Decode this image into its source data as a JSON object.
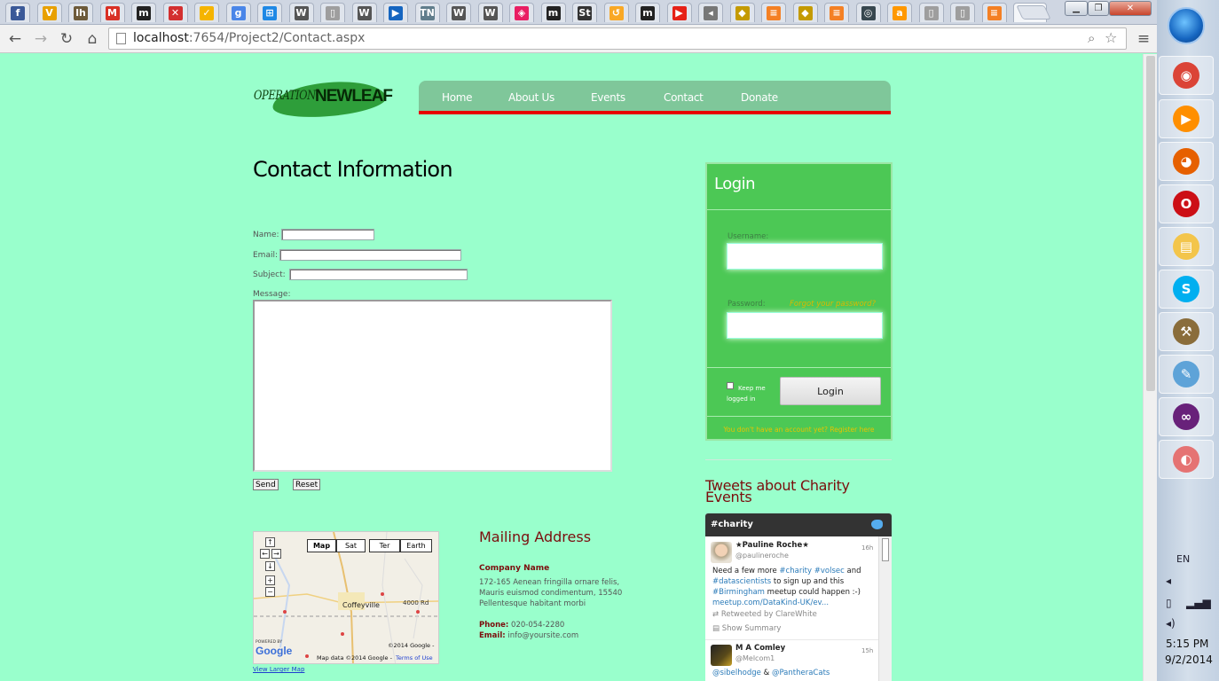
{
  "browser": {
    "tabs": [
      {
        "icon": "facebook-icon",
        "glyph": "f",
        "color": "#3b5998"
      },
      {
        "icon": "v-icon",
        "glyph": "V",
        "color": "#e8a000"
      },
      {
        "icon": "lh-icon",
        "glyph": "lh",
        "color": "#6d5a3a"
      },
      {
        "icon": "gmail-icon",
        "glyph": "M",
        "color": "#d93025"
      },
      {
        "icon": "m-icon",
        "glyph": "m",
        "color": "#222222"
      },
      {
        "icon": "x-icon",
        "glyph": "✕",
        "color": "#d32f2f"
      },
      {
        "icon": "check-icon",
        "glyph": "✓",
        "color": "#f5b400"
      },
      {
        "icon": "g-icon",
        "glyph": "g",
        "color": "#4a86e8"
      },
      {
        "icon": "windows-icon",
        "glyph": "⊞",
        "color": "#1e88e5"
      },
      {
        "icon": "wikipedia-icon",
        "glyph": "W",
        "color": "#555555"
      },
      {
        "icon": "page-icon",
        "glyph": "▯",
        "color": "#9e9e9e"
      },
      {
        "icon": "wikipedia-icon",
        "glyph": "W",
        "color": "#555555"
      },
      {
        "icon": "flag-icon",
        "glyph": "▶",
        "color": "#1565c0"
      },
      {
        "icon": "tn-icon",
        "glyph": "TN",
        "color": "#607d8b"
      },
      {
        "icon": "wikipedia-icon",
        "glyph": "W",
        "color": "#555555"
      },
      {
        "icon": "wikipedia-icon",
        "glyph": "W",
        "color": "#555555"
      },
      {
        "icon": "tag-icon",
        "glyph": "◈",
        "color": "#e91e63"
      },
      {
        "icon": "m-icon",
        "glyph": "m",
        "color": "#222222"
      },
      {
        "icon": "st-icon",
        "glyph": "St",
        "color": "#333333"
      },
      {
        "icon": "arrow-icon",
        "glyph": "↺",
        "color": "#f9a825"
      },
      {
        "icon": "m-icon",
        "glyph": "m",
        "color": "#222222"
      },
      {
        "icon": "youtube-icon",
        "glyph": "▶",
        "color": "#e62117"
      },
      {
        "icon": "speaker-icon",
        "glyph": "◂",
        "color": "#777777"
      },
      {
        "icon": "shield-icon",
        "glyph": "◆",
        "color": "#c49a00"
      },
      {
        "icon": "stack-icon",
        "glyph": "≡",
        "color": "#f48024"
      },
      {
        "icon": "shield-icon",
        "glyph": "◆",
        "color": "#c49a00"
      },
      {
        "icon": "stack-icon",
        "glyph": "≡",
        "color": "#f48024"
      },
      {
        "icon": "circle-icon",
        "glyph": "◎",
        "color": "#37474f"
      },
      {
        "icon": "a-icon",
        "glyph": "a",
        "color": "#ff9800"
      },
      {
        "icon": "page-icon",
        "glyph": "▯",
        "color": "#9e9e9e"
      },
      {
        "icon": "page-icon",
        "glyph": "▯",
        "color": "#9e9e9e"
      },
      {
        "icon": "stack-icon",
        "glyph": "≡",
        "color": "#f48024"
      }
    ],
    "active_tab_close": "×",
    "url_host": "localhost",
    "url_rest": ":7654/Project2/Contact.aspx"
  },
  "site": {
    "logo": {
      "part1": "OPERATION",
      "part2": "NEWLEAF"
    },
    "nav": [
      "Home",
      "About Us",
      "Events",
      "Contact",
      "Donate"
    ]
  },
  "contact": {
    "title": "Contact Information",
    "name_label": "Name:",
    "email_label": "Email:",
    "subject_label": "Subject:",
    "message_label": "Message:",
    "send_label": "Send",
    "reset_label": "Reset"
  },
  "map": {
    "controls": {
      "up": "↑",
      "left": "←",
      "right": "→",
      "down": "↓",
      "zoom_in": "+",
      "zoom_out": "−"
    },
    "types": [
      "Map",
      "Sat",
      "Ter",
      "Earth"
    ],
    "city": "Coffeyville",
    "road": "4000 Rd",
    "copyright": "©2014 Google -",
    "powered": "POWERED BY",
    "google": "Google",
    "mapdata": "Map data ©2014 Google -",
    "terms": "Terms of Use",
    "larger": "View Larger Map"
  },
  "mailing": {
    "title": "Mailing Address",
    "company": "Company Name",
    "address": [
      "172-165 Aenean fringilla ornare felis,",
      "Mauris euismod condimentum, 15540",
      "Pellentesque habitant morbi"
    ],
    "phone_label": "Phone:",
    "phone": "020-054-2280",
    "email_label": "Email:",
    "email": "info@yoursite.com"
  },
  "login": {
    "title": "Login",
    "username_label": "Username:",
    "password_label": "Password:",
    "forgot": "Forgot your password?",
    "keep_me": "Keep me logged in",
    "login_button": "Login",
    "register": "You don't have an account yet? Register here"
  },
  "tweets": {
    "title": "Tweets about Charity Events",
    "hashtag": "#charity",
    "items": [
      {
        "name": "★Pauline Roche★",
        "handle": "@paulineroche",
        "time": "16h",
        "text": [
          "Need a few more ",
          "#charity",
          " ",
          "#volsec",
          " and"
        ],
        "text2": [
          "#datascientists",
          " to sign up and this"
        ],
        "text3": [
          "#Birmingham",
          " meetup could happen :-)"
        ],
        "text4": [
          "meetup.com/DataKind-UK/ev..."
        ],
        "retweet": "Retweeted by ClareWhite",
        "summary": "Show Summary"
      },
      {
        "name": "M A Comley",
        "handle": "@Melcom1",
        "time": "15h",
        "text": [
          "@sibelhodge",
          " & ",
          "@PantheraCats"
        ]
      }
    ]
  },
  "taskbar": {
    "apps": [
      {
        "name": "chrome-icon",
        "glyph": "◉",
        "color": "#db4437"
      },
      {
        "name": "media-player-icon",
        "glyph": "▶",
        "color": "#ff8f00"
      },
      {
        "name": "firefox-icon",
        "glyph": "◕",
        "color": "#e66000"
      },
      {
        "name": "opera-icon",
        "glyph": "O",
        "color": "#cc0f16"
      },
      {
        "name": "explorer-icon",
        "glyph": "▤",
        "color": "#f3c54b"
      },
      {
        "name": "skype-icon",
        "glyph": "S",
        "color": "#00aff0"
      },
      {
        "name": "tools-icon",
        "glyph": "⚒",
        "color": "#8a6d3b"
      },
      {
        "name": "notepad-icon",
        "glyph": "✎",
        "color": "#5ea3d8"
      },
      {
        "name": "vs-icon",
        "glyph": "∞",
        "color": "#68217a"
      },
      {
        "name": "paint-icon",
        "glyph": "◐",
        "color": "#e57373"
      }
    ],
    "lang": "EN",
    "time": "5:15 PM",
    "date": "9/2/2014"
  }
}
